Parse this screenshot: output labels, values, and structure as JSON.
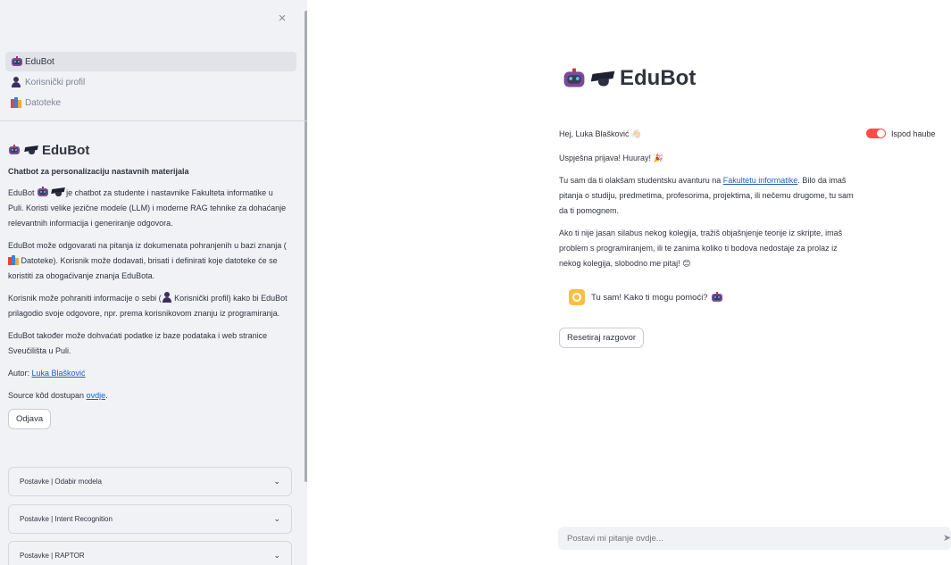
{
  "sidebar": {
    "close_symbol": "×",
    "nav": [
      {
        "label": "EduBot",
        "icon": "robot-icon",
        "active": true
      },
      {
        "label": "Korisnički profil",
        "icon": "person-icon",
        "active": false
      },
      {
        "label": "Datoteke",
        "icon": "books-icon",
        "active": false
      }
    ],
    "title": "EduBot",
    "subtitle": "Chatbot za personalizaciju nastavnih materijala",
    "p1_a": "EduBot",
    "p1_b": " je chatbot za studente i nastavnike Fakulteta informatike u Puli. Koristi velike jezične modele (LLM) i moderne RAG tehnike za dohaćanje relevantnih informacija i generiranje odgovora.",
    "p2_a": "EduBot može odgovarati na pitanja iz dokumenata pohranjenih u bazi znanja (",
    "p2_b": " Datoteke). Korisnik može dodavati, brisati i definirati koje datoteke će se koristiti za obogaćivanje znanja EduBota.",
    "p3_a": "Korisnik može pohraniti informacije o sebi (",
    "p3_b": " Korisnički profil) kako bi EduBot prilagodio svoje odgovore, npr. prema korisnikovom znanju iz programiranja.",
    "p4": "EduBot također može dohvaćati podatke iz baze podataka i web stranice Sveučilišta u Puli.",
    "author_label": "Autor: ",
    "author_link": "Luka Blašković",
    "source_label": "Source kôd dostupan ",
    "source_link": "ovdje",
    "source_end": ".",
    "logout": "Odjava",
    "expanders": [
      "Postavke | Odabir modela",
      "Postavke | Intent Recognition",
      "Postavke | RAPTOR"
    ]
  },
  "main": {
    "title": "EduBot",
    "greeting": "Hej, Luka Blašković 👋🏻",
    "login_success": "Uspješna prijava! Huuray! 🎉",
    "p1_a": "Tu sam da ti olakšam studentsku avanturu na ",
    "p1_link": "Fakultetu informatike",
    "p1_b": ". Bilo da imaš pitanja o studiju, predmetima, profesorima, projektima, ili nečemu drugome, tu sam da ti pomognem.",
    "p2": "Ako ti nije jasan silabus nekog kolegija, tražiš objašnjenje teorije iz skripte, imaš problem s programiranjem, ili te zanima koliko ti bodova nedostaje za prolaz iz nekog kolegija, slobodno me pitaj! 😊",
    "toggle_label": "Ispod haube",
    "toggle_on": true,
    "assistant_message": "Tu sam! Kako ti mogu pomoći?",
    "reset_button": "Resetiraj razgovor",
    "input_placeholder": "Postavi mi pitanje ovdje...",
    "send_symbol": "➤"
  },
  "colors": {
    "sidebar_bg": "#f0f2f6",
    "accent": "#ff4b4b",
    "link": "#1f5fbf",
    "assistant_avatar": "#ffbd45"
  }
}
